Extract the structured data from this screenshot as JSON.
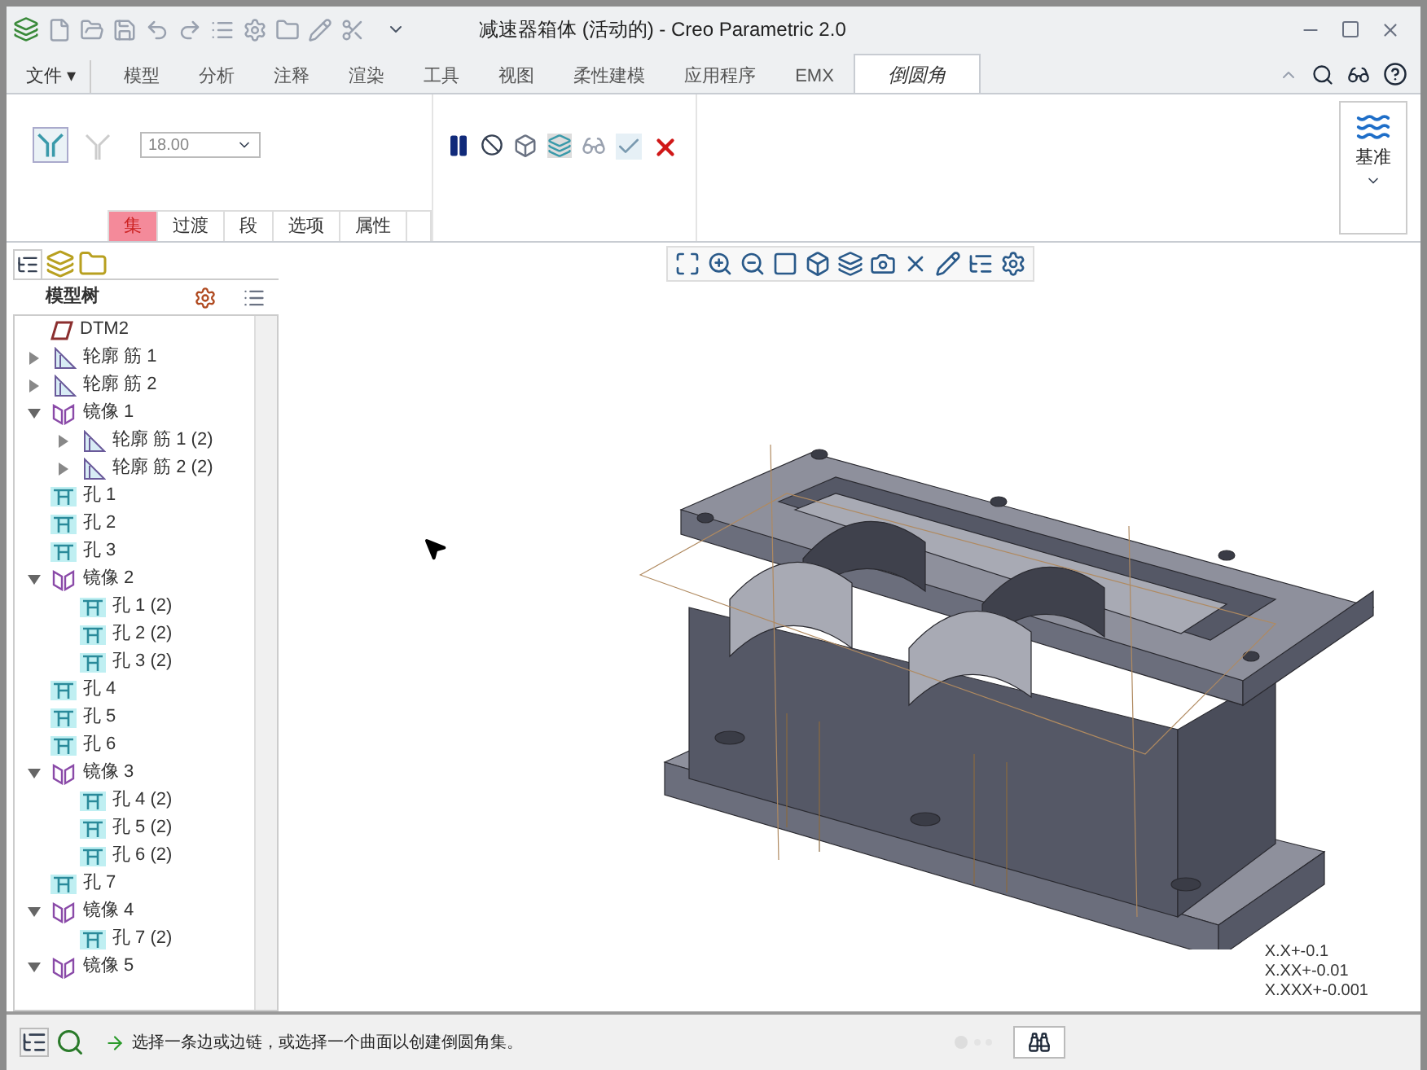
{
  "window": {
    "title": "减速器箱体 (活动的) - Creo Parametric 2.0"
  },
  "menu_button": {
    "label": "文件",
    "caret": "▾"
  },
  "ribbon_tabs": [
    {
      "label": "模型",
      "selected": false
    },
    {
      "label": "分析",
      "selected": false
    },
    {
      "label": "注释",
      "selected": false
    },
    {
      "label": "渲染",
      "selected": false
    },
    {
      "label": "工具",
      "selected": false
    },
    {
      "label": "视图",
      "selected": false
    },
    {
      "label": "柔性建模",
      "selected": false
    },
    {
      "label": "应用程序",
      "selected": false
    },
    {
      "label": "EMX",
      "selected": false
    },
    {
      "label": "倒圆角",
      "selected": true
    }
  ],
  "fillet_ribbon": {
    "radius": {
      "value": "18.00"
    },
    "sub_tabs": [
      {
        "label": "集",
        "selected": true
      },
      {
        "label": "过渡",
        "selected": false
      },
      {
        "label": "段",
        "selected": false
      },
      {
        "label": "选项",
        "selected": false
      },
      {
        "label": "属性",
        "selected": false
      }
    ],
    "datum_group": {
      "label": "基准"
    }
  },
  "model_tree": {
    "title": "模型树",
    "items": [
      {
        "label": "DTM2",
        "kind": "datum"
      },
      {
        "label": "轮廓 筋 1",
        "kind": "rib",
        "expanded": false
      },
      {
        "label": "轮廓 筋 2",
        "kind": "rib",
        "expanded": false
      },
      {
        "label": "镜像 1",
        "kind": "mirror",
        "expanded": true,
        "children": [
          {
            "label": "轮廓 筋 1 (2)",
            "kind": "rib",
            "expanded": false
          },
          {
            "label": "轮廓 筋 2 (2)",
            "kind": "rib",
            "expanded": false
          }
        ]
      },
      {
        "label": "孔 1",
        "kind": "hole"
      },
      {
        "label": "孔 2",
        "kind": "hole"
      },
      {
        "label": "孔 3",
        "kind": "hole"
      },
      {
        "label": "镜像 2",
        "kind": "mirror",
        "expanded": true,
        "children": [
          {
            "label": "孔 1 (2)",
            "kind": "hole"
          },
          {
            "label": "孔 2 (2)",
            "kind": "hole"
          },
          {
            "label": "孔 3 (2)",
            "kind": "hole"
          }
        ]
      },
      {
        "label": "孔 4",
        "kind": "hole"
      },
      {
        "label": "孔 5",
        "kind": "hole"
      },
      {
        "label": "孔 6",
        "kind": "hole"
      },
      {
        "label": "镜像 3",
        "kind": "mirror",
        "expanded": true,
        "children": [
          {
            "label": "孔 4 (2)",
            "kind": "hole"
          },
          {
            "label": "孔 5 (2)",
            "kind": "hole"
          },
          {
            "label": "孔 6 (2)",
            "kind": "hole"
          }
        ]
      },
      {
        "label": "孔 7",
        "kind": "hole"
      },
      {
        "label": "镜像 4",
        "kind": "mirror",
        "expanded": true,
        "children": [
          {
            "label": "孔 7 (2)",
            "kind": "hole"
          }
        ]
      },
      {
        "label": "镜像 5",
        "kind": "mirror",
        "expanded": true
      }
    ]
  },
  "tolerances": [
    "X.X+-0.1",
    "X.XX+-0.01",
    "X.XXX+-0.001"
  ],
  "status_bar": {
    "message": "选择一条边或边链，或选择一个曲面以创建倒圆角集。"
  }
}
